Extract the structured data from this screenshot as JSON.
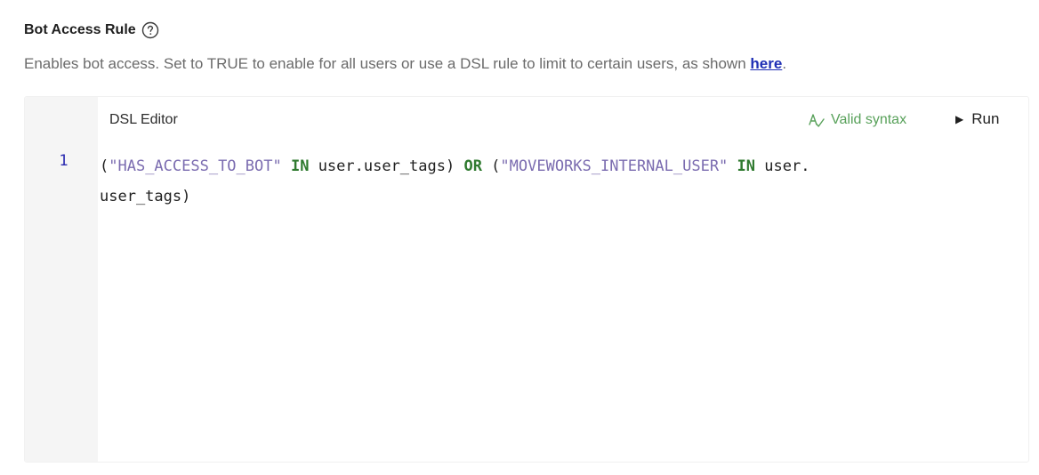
{
  "header": {
    "title": "Bot Access Rule",
    "help_icon": "question-circle-icon"
  },
  "description": {
    "text": "Enables bot access. Set to TRUE to enable for all users or use a DSL rule to limit to certain users, as shown ",
    "link_text": "here",
    "suffix": "."
  },
  "editor": {
    "title": "DSL Editor",
    "status_icon": "syntax-check-icon",
    "status_text": "Valid syntax",
    "run_icon": "play-icon",
    "run_label": "Run",
    "line_number": "1",
    "code_tokens": [
      {
        "text": "(",
        "kind": "plain"
      },
      {
        "text": "\"HAS_ACCESS_TO_BOT\"",
        "kind": "str"
      },
      {
        "text": " ",
        "kind": "plain"
      },
      {
        "text": "IN",
        "kind": "kw"
      },
      {
        "text": " user.user_tags) ",
        "kind": "plain"
      },
      {
        "text": "OR",
        "kind": "kw"
      },
      {
        "text": " (",
        "kind": "plain"
      },
      {
        "text": "\"MOVEWORKS_INTERNAL_USER\"",
        "kind": "str"
      },
      {
        "text": " ",
        "kind": "plain"
      },
      {
        "text": "IN",
        "kind": "kw"
      },
      {
        "text": " user.",
        "kind": "plain"
      },
      {
        "text": "user_tags)",
        "kind": "plain",
        "break_before": true
      }
    ]
  },
  "colors": {
    "string": "#7b6cb0",
    "keyword": "#2f7a2f",
    "valid": "#58a15a",
    "link": "#1f2fb5"
  }
}
